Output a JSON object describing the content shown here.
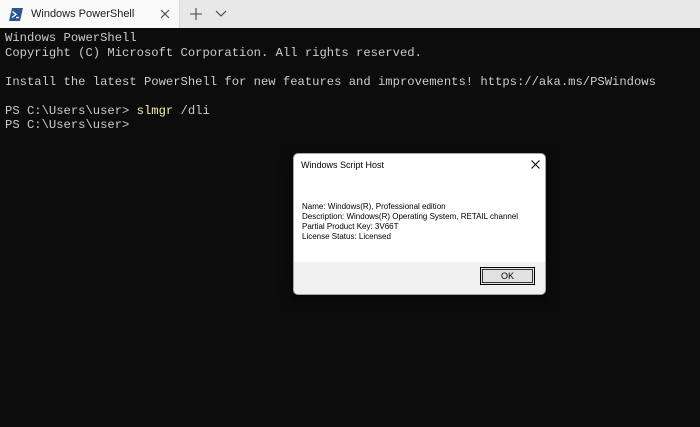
{
  "tab": {
    "title": "Windows PowerShell",
    "icon": "powershell-icon"
  },
  "colors": {
    "terminal_bg": "#0c0c0c",
    "terminal_text": "#cccccc",
    "command_highlight": "#f9f1a5",
    "tabbar_bg": "#e8e8e8"
  },
  "terminal": {
    "lines": [
      "Windows PowerShell",
      "Copyright (C) Microsoft Corporation. All rights reserved.",
      "",
      "Install the latest PowerShell for new features and improvements! https://aka.ms/PSWindows",
      ""
    ],
    "prompt1": "PS C:\\Users\\user> ",
    "command1_name": "slmgr",
    "command1_args": " /dli",
    "prompt2": "PS C:\\Users\\user>"
  },
  "dialog": {
    "title": "Windows Script Host",
    "lines": [
      "Name: Windows(R), Professional edition",
      "Description: Windows(R) Operating System, RETAIL channel",
      "Partial Product Key: 3V66T",
      "License Status: Licensed"
    ],
    "ok_label": "OK"
  }
}
